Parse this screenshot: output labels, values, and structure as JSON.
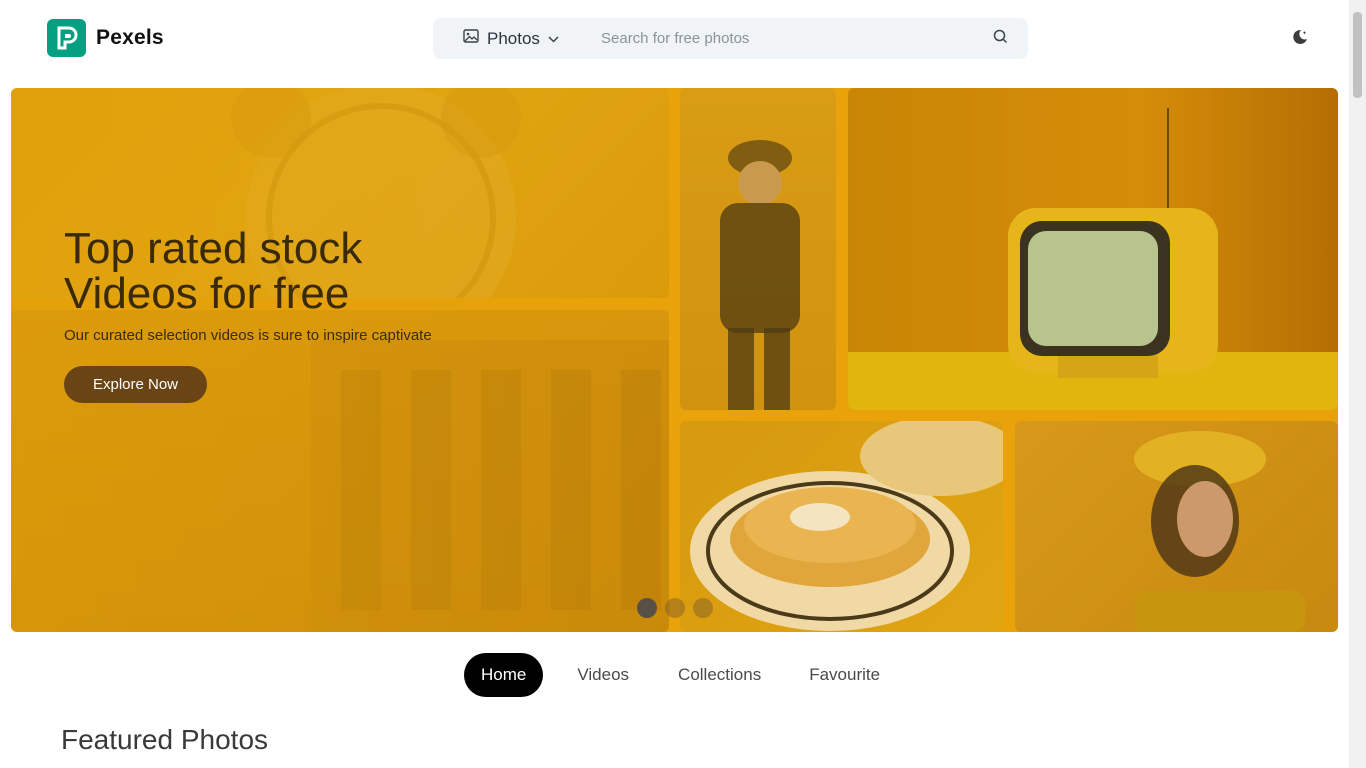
{
  "header": {
    "brand": "Pexels",
    "search": {
      "type_label": "Photos",
      "placeholder": "Search for free photos"
    }
  },
  "hero": {
    "title_line1": "Top rated stock",
    "title_line2": "Videos for free",
    "subtitle": "Our curated selection videos is sure to inspire captivate",
    "cta_label": "Explore Now",
    "slide_count": 3,
    "active_slide": 1
  },
  "nav": {
    "tabs": [
      {
        "label": "Home",
        "active": true
      },
      {
        "label": "Videos",
        "active": false
      },
      {
        "label": "Collections",
        "active": false
      },
      {
        "label": "Favourite",
        "active": false
      }
    ]
  },
  "featured": {
    "title": "Featured Photos"
  },
  "colors": {
    "brand": "#05a081",
    "hero_tint": "#e9a20a",
    "cta_bg": "#6b4415",
    "active_tab_bg": "#000000"
  },
  "icons": {
    "search_type": "image-icon",
    "dropdown": "chevron-down-icon",
    "search": "search-icon",
    "theme": "moon-icon"
  }
}
